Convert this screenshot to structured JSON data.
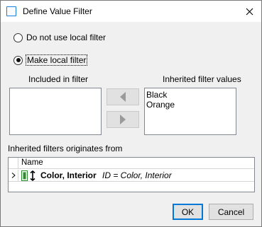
{
  "window": {
    "title": "Define Value Filter"
  },
  "options": {
    "no_local": "Do not use local filter",
    "make_local": "Make local filter",
    "selected": "make_local"
  },
  "included": {
    "label": "Included in filter",
    "items": []
  },
  "inherited": {
    "label": "Inherited filter values",
    "items": [
      "Black",
      "Orange"
    ]
  },
  "origins": {
    "label": "Inherited filters originates from",
    "column_name": "Name",
    "rows": [
      {
        "name": "Color, Interior",
        "meta": "ID = Color, Interior"
      }
    ]
  },
  "buttons": {
    "ok": "OK",
    "cancel": "Cancel"
  },
  "icons": {
    "app": "window-icon",
    "close": "close-icon",
    "add": "arrow-left-icon",
    "remove": "arrow-right-icon",
    "expand": "chevron-right-icon",
    "node": "attribute-icon"
  },
  "colors": {
    "accent": "#0078d7",
    "arrow": "#9a9a9a",
    "node_green": "#2e8b2e"
  }
}
